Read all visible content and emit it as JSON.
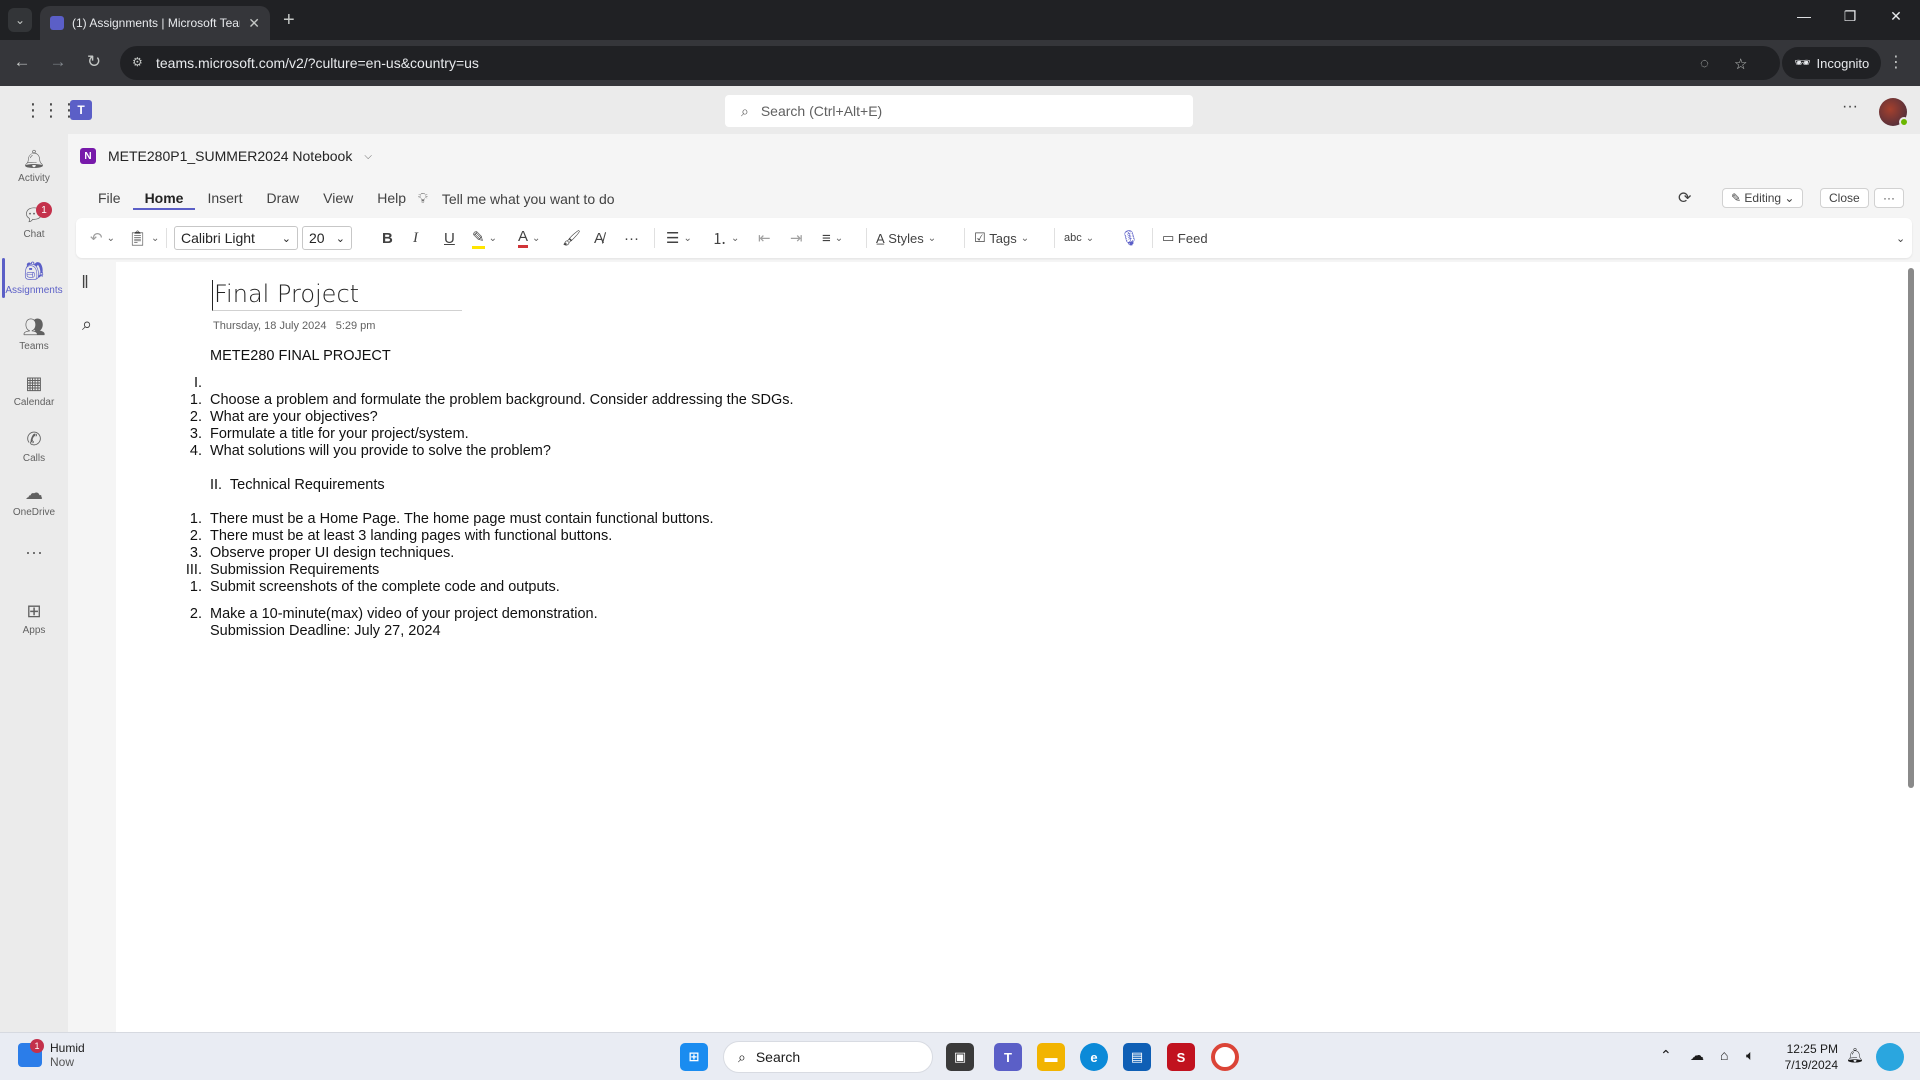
{
  "browser": {
    "tab_title": "(1) Assignments | Microsoft Teams",
    "url": "teams.microsoft.com/v2/?culture=en-us&country=us",
    "incognito_label": "Incognito"
  },
  "teams": {
    "search_placeholder": "Search (Ctrl+Alt+E)",
    "rail": [
      {
        "label": "Activity"
      },
      {
        "label": "Chat",
        "badge": "1"
      },
      {
        "label": "Assignments"
      },
      {
        "label": "Teams"
      },
      {
        "label": "Calendar"
      },
      {
        "label": "Calls"
      },
      {
        "label": "OneDrive"
      },
      {
        "label": "Apps"
      }
    ]
  },
  "onenote": {
    "notebook_title": "METE280P1_SUMMER2024 Notebook",
    "menu_tabs": [
      "File",
      "Home",
      "Insert",
      "Draw",
      "View",
      "Help"
    ],
    "tell_me": "Tell me what you want to do",
    "editing_label": "Editing",
    "close_label": "Close",
    "font_name": "Calibri Light",
    "font_size": "20",
    "styles_label": "Styles",
    "tags_label": "Tags",
    "feed_label": "Feed",
    "spell_label": "abc"
  },
  "page": {
    "title": "Final Project",
    "date": "Thursday, 18 July 2024",
    "time": "5:29 pm",
    "heading": "METE280 FINAL PROJECT",
    "lines": [
      {
        "num": "I.",
        "text": ""
      },
      {
        "num": "1.",
        "text": "Choose a problem and formulate the problem background. Consider addressing the SDGs."
      },
      {
        "num": "2.",
        "text": "What are your objectives?"
      },
      {
        "num": "3.",
        "text": "Formulate a title for your project/system."
      },
      {
        "num": "4.",
        "text": "What solutions will you provide to solve the problem?"
      },
      {
        "num": "",
        "text": ""
      },
      {
        "num": "",
        "text": "II.  Technical Requirements"
      },
      {
        "num": "",
        "text": ""
      },
      {
        "num": "1.",
        "text": "There must be a Home Page. The home page must contain functional buttons."
      },
      {
        "num": "2.",
        "text": "There must be at least 3 landing pages with functional buttons."
      },
      {
        "num": "3.",
        "text": "Observe proper UI design techniques."
      },
      {
        "num": "III.",
        "text": "Submission Requirements"
      },
      {
        "num": "1.",
        "text": "Submit screenshots of the complete code and outputs."
      },
      {
        "num": "2.",
        "text": "Make a 10-minute(max) video of your project demonstration."
      },
      {
        "num": "",
        "text": "Submission Deadline: July 27, 2024"
      }
    ]
  },
  "taskbar": {
    "weather_label": "Humid",
    "weather_sub": "Now",
    "weather_badge": "1",
    "search_label": "Search",
    "time": "12:25 PM",
    "date": "7/19/2024"
  }
}
